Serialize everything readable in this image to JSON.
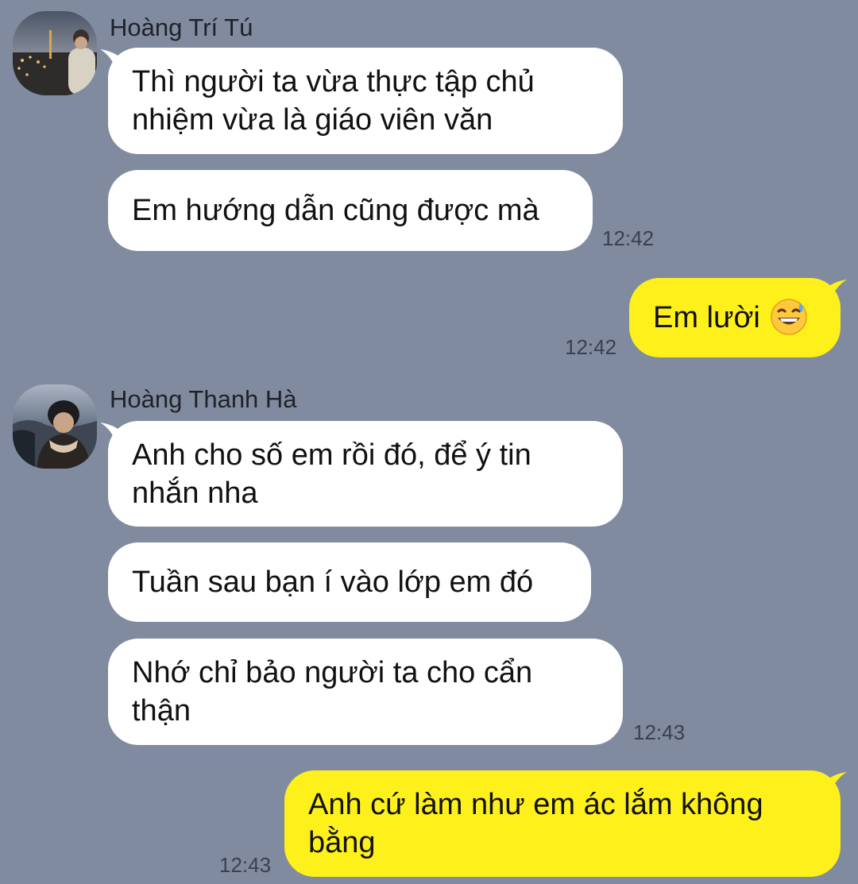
{
  "messages": [
    {
      "sender": "Hoàng Trí Tú",
      "bubbles": [
        "Thì người ta vừa thực tập chủ nhiệm vừa là giáo viên văn",
        "Em hướng dẫn cũng được mà"
      ],
      "time": "12:42"
    },
    {
      "outgoing": true,
      "text": "Em lười",
      "emoji": "grinning-face-with-sweat-icon",
      "time": "12:42"
    },
    {
      "sender": "Hoàng Thanh Hà",
      "bubbles": [
        "Anh cho số em rồi đó, để ý tin nhắn nha",
        "Tuần sau bạn í vào lớp em đó",
        "Nhớ chỉ bảo người ta cho cẩn thận"
      ],
      "time": "12:43"
    },
    {
      "outgoing": true,
      "text": "Anh cứ làm như em ác lắm không bằng",
      "time": "12:43"
    }
  ],
  "colors": {
    "background": "#808ba0",
    "incoming_bubble": "#ffffff",
    "outgoing_bubble": "#fef01b"
  }
}
